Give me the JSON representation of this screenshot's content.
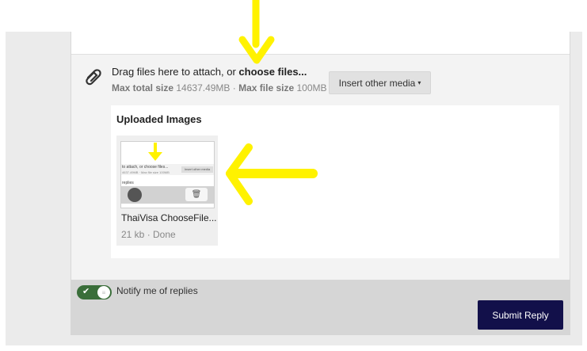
{
  "attach": {
    "drag_text": "Drag files here to attach, or ",
    "choose_files": "choose files...",
    "max_total_label": "Max total size",
    "max_total_value": "14637.49MB",
    "separator": " · ",
    "max_file_label": "Max file size",
    "max_file_value": "100MB",
    "insert_media_label": "Insert other media",
    "insert_media_caret": "▾"
  },
  "uploads": {
    "title": "Uploaded Images",
    "files": [
      {
        "name": "ThaiVisa ChooseFile...",
        "status": "21 kb · Done",
        "preview": {
          "attach_text": "to attach, or choose files...",
          "size_text": "4637.49MB · Max file size 100MB",
          "insert_label": "Insert other media",
          "replies_text": "replies",
          "trash_glyph": "🗑"
        }
      }
    ]
  },
  "footer": {
    "notify_label": "Notify me of replies",
    "notify_on": true,
    "toggle_check": "✔",
    "toggle_knob_glyph": "≡",
    "submit_label": "Submit Reply"
  },
  "colors": {
    "submit_bg": "#12104a",
    "toggle_on": "#3a6e3a",
    "highlight_arrow": "#fff200"
  }
}
